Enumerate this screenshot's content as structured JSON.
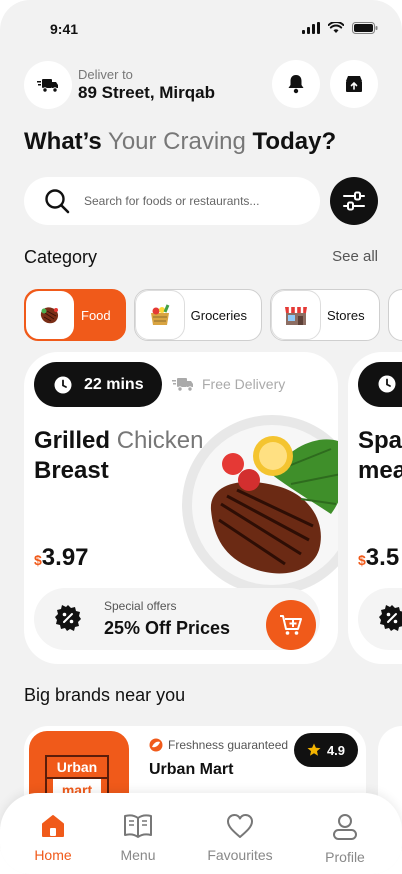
{
  "status_bar": {
    "time": "9:41"
  },
  "header": {
    "deliver_label": "Deliver to",
    "address": "89 Street, Mirqab"
  },
  "headline": {
    "part1": "What’s",
    "part2": "Your Craving",
    "part3": "Today?"
  },
  "search": {
    "placeholder": "Search for foods or restaurants..."
  },
  "category": {
    "title": "Category",
    "see_all": "See all",
    "chips": [
      {
        "label": "Food",
        "icon": "steak-icon",
        "active": true
      },
      {
        "label": "Groceries",
        "icon": "groceries-icon",
        "active": false
      },
      {
        "label": "Stores",
        "icon": "store-icon",
        "active": false
      }
    ]
  },
  "featured": [
    {
      "time": "22 mins",
      "delivery": "Free Delivery",
      "title_bold": "Grilled",
      "title_light": "Chicken",
      "title_line2": "Breast",
      "currency": "$",
      "price": "3.97",
      "offer_label": "Special offers",
      "offer_text": "25% Off Prices"
    },
    {
      "title_line1": "Spa",
      "title_line2": "mea",
      "currency": "$",
      "price": "3.5"
    }
  ],
  "brands": {
    "title": "Big brands near you",
    "items": [
      {
        "logo_top": "Urban",
        "logo_bottom": "mart",
        "tag": "Freshness guaranteed",
        "name": "Urban Mart",
        "rating": "4.9"
      }
    ]
  },
  "nav": {
    "items": [
      {
        "label": "Home",
        "icon": "home-icon",
        "active": true
      },
      {
        "label": "Menu",
        "icon": "book-icon",
        "active": false
      },
      {
        "label": "Favourites",
        "icon": "heart-icon",
        "active": false
      },
      {
        "label": "Profile",
        "icon": "profile-icon",
        "active": false
      }
    ]
  },
  "colors": {
    "accent": "#f05a1a",
    "dark": "#111111",
    "background": "#f2f2f2"
  }
}
